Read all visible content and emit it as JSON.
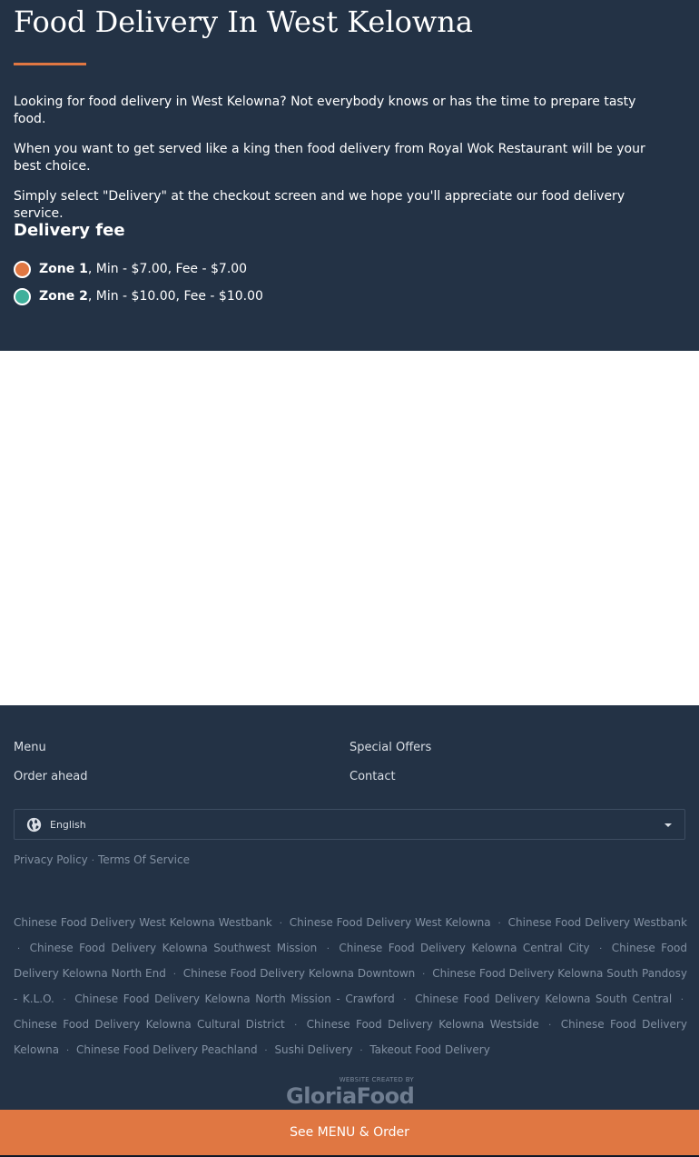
{
  "colors": {
    "background": "#233245",
    "accent": "#e07742",
    "zone1": "#e07742",
    "zone2": "#3fb09b",
    "map_background": "#ffffff"
  },
  "hero": {
    "title": "Food Delivery In West Kelowna",
    "paragraphs": [
      "Looking for food delivery in West Kelowna? Not everybody knows or has the time to prepare tasty food.",
      "When you want to get served like a king then food delivery from Royal Wok Restaurant will be your best choice.",
      "Simply select \"Delivery\" at the checkout screen and we hope you'll appreciate our food delivery service."
    ],
    "delivery_fee_heading": "Delivery fee",
    "zones": [
      {
        "name": "Zone 1",
        "details": ", Min - $7.00, Fee - $7.00"
      },
      {
        "name": "Zone 2",
        "details": ", Min - $10.00, Fee - $10.00"
      }
    ]
  },
  "footer": {
    "links": {
      "menu": "Menu",
      "special_offers": "Special Offers",
      "order_ahead": "Order ahead",
      "contact": "Contact"
    },
    "language": {
      "icon": "globe-icon",
      "selected": "English"
    },
    "legal": {
      "privacy": "Privacy Policy",
      "terms": "Terms Of Service",
      "separator": "·"
    },
    "seo_links": [
      "Chinese Food Delivery West Kelowna Westbank",
      "Chinese Food Delivery West Kelowna",
      "Chinese Food Delivery Westbank",
      "Chinese Food Delivery Kelowna Southwest Mission",
      "Chinese Food Delivery Kelowna Central City",
      "Chinese Food Delivery Kelowna North End",
      "Chinese Food Delivery Kelowna Downtown",
      "Chinese Food Delivery Kelowna South Pandosy - K.L.O.",
      "Chinese Food Delivery Kelowna North Mission - Crawford",
      "Chinese Food Delivery Kelowna South Central",
      "Chinese Food Delivery Kelowna Cultural District",
      "Chinese Food Delivery Kelowna Westside",
      "Chinese Food Delivery Kelowna",
      "Chinese Food Delivery Peachland",
      "Sushi Delivery",
      "Takeout Food Delivery"
    ],
    "credit": {
      "small": "WEBSITE CREATED BY",
      "logo": "GloriaFood"
    }
  },
  "cta": {
    "label": "See MENU & Order"
  }
}
